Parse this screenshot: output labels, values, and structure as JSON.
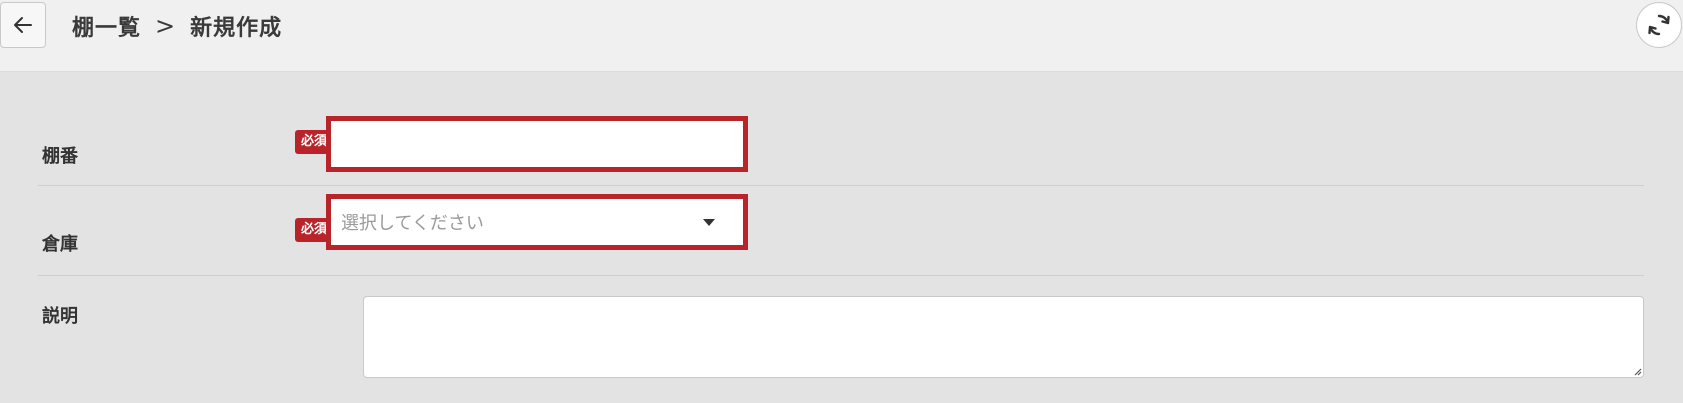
{
  "header": {
    "breadcrumb_parent": "棚一覧",
    "breadcrumb_separator": ">",
    "breadcrumb_current": "新規作成",
    "back_icon": "arrow-left-icon",
    "refresh_icon": "refresh-icon"
  },
  "form": {
    "shelf_number": {
      "label": "棚番",
      "required_badge": "必須",
      "value": ""
    },
    "warehouse": {
      "label": "倉庫",
      "required_badge": "必須",
      "placeholder": "選択してください",
      "icon": "caret-down-icon"
    },
    "description": {
      "label": "説明",
      "value": ""
    }
  },
  "colors": {
    "required_accent": "#b8242a",
    "header_bg": "#f0f0f0",
    "form_bg": "#e3e3e3"
  }
}
